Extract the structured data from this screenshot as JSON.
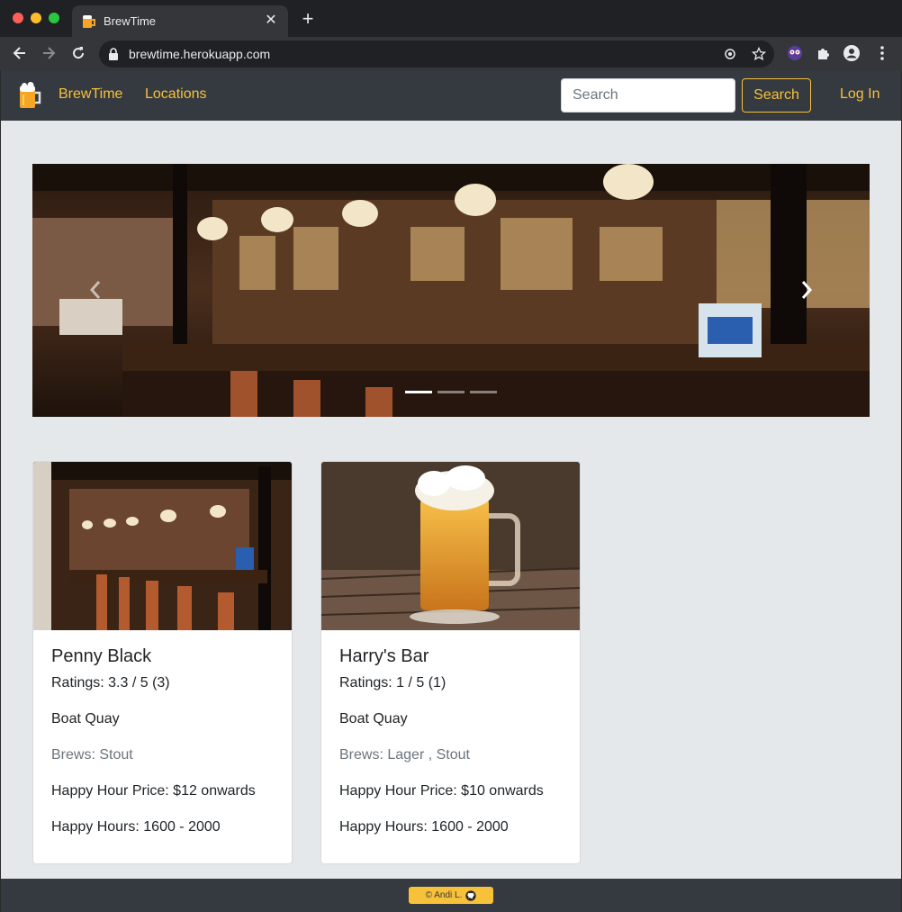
{
  "browser": {
    "tab_title": "BrewTime",
    "url": "brewtime.herokuapp.com"
  },
  "navbar": {
    "brand": "BrewTime",
    "locations": "Locations",
    "search_placeholder": "Search",
    "search_button": "Search",
    "login": "Log In"
  },
  "carousel": {
    "slides": 3,
    "active_slide": 1
  },
  "cards": [
    {
      "name": "Penny Black",
      "ratings": "Ratings: 3.3 / 5 (3)",
      "location": "Boat Quay",
      "brews": "Brews: Stout",
      "price": "Happy Hour Price: $12 onwards",
      "hours": "Happy Hours: 1600 - 2000"
    },
    {
      "name": "Harry's Bar",
      "ratings": "Ratings: 1 / 5 (1)",
      "location": "Boat Quay",
      "brews": "Brews: Lager , Stout",
      "price": "Happy Hour Price: $10 onwards",
      "hours": "Happy Hours: 1600 - 2000"
    }
  ],
  "footer": {
    "credit": "© Andi L."
  },
  "colors": {
    "accent": "#f8c13a",
    "navbar": "#343a40",
    "page_bg": "#e5e8ea"
  }
}
